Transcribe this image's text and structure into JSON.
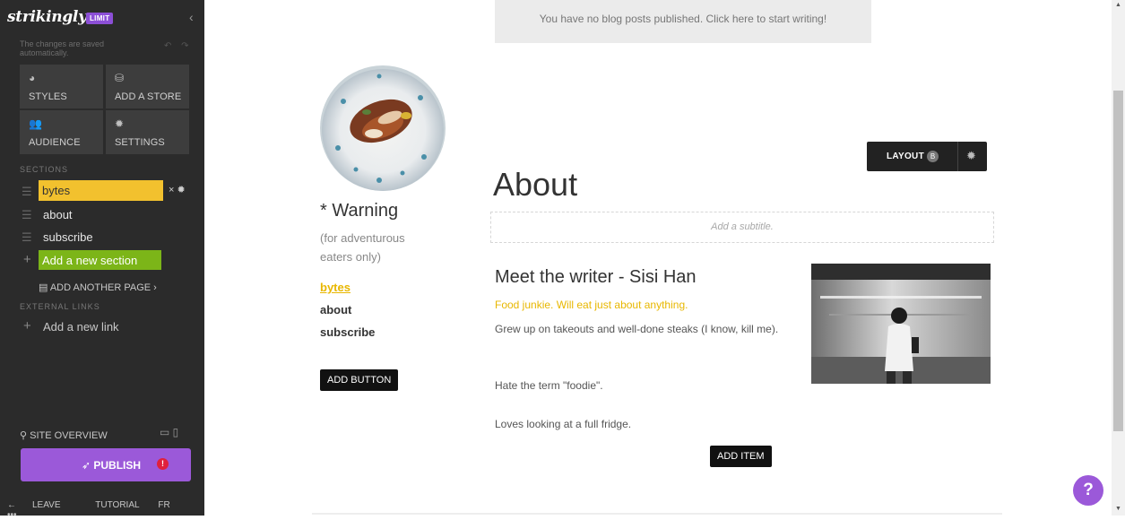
{
  "sidebar": {
    "logo": "strikingly",
    "badge": "LIMIT",
    "collapse_icon": "‹",
    "saved_note": "The changes are saved automatically.",
    "undo_redo_icons": "↶ ↷",
    "tiles": [
      {
        "label": "STYLES",
        "icon": "◕"
      },
      {
        "label": "ADD A STORE",
        "icon": "⛁"
      },
      {
        "label": "AUDIENCE",
        "icon": "👥"
      },
      {
        "label": "SETTINGS",
        "icon": "✹"
      }
    ],
    "sections_heading": "SECTIONS",
    "sections": [
      {
        "label": "bytes",
        "active": true
      },
      {
        "label": "about"
      },
      {
        "label": "subscribe"
      }
    ],
    "section_tools": "× ✹",
    "add_section": "Add a new section",
    "add_page": "ADD ANOTHER PAGE ›",
    "external_links_heading": "EXTERNAL LINKS",
    "add_link": "Add a new link",
    "site_overview": "SITE OVERVIEW",
    "device_icons": "▭ ▯",
    "publish": "PUBLISH",
    "publish_alert": "!",
    "bottom": {
      "leave": "LEAVE",
      "tutorial": "TUTORIAL",
      "lang": "FR",
      "more": "•••"
    }
  },
  "main": {
    "blog_banner": "You have no blog posts published. Click here to start writing!",
    "site_title": "* Warning",
    "site_subtitle": "(for adventurous eaters only)",
    "nav": [
      "bytes",
      "about",
      "subscribe"
    ],
    "add_button": "ADD BUTTON",
    "layout_button": "LAYOUT",
    "layout_badge": "B",
    "section_title": "About",
    "subtitle_placeholder": "Add a subtitle.",
    "item": {
      "title": "Meet the writer - Sisi Han",
      "tagline": "Food junkie. Will eat just about anything.",
      "paragraphs": [
        "Grew up on takeouts and well-done steaks (I know, kill me).",
        "Hate the term \"foodie\".",
        "Loves looking at a full fridge."
      ]
    },
    "add_item": "ADD ITEM",
    "help": "?"
  },
  "colors": {
    "sidebar_bg": "#2b2b2b",
    "accent_purple": "#9b59d9",
    "active_yellow": "#f2c12e",
    "add_green": "#7cb518",
    "link_gold": "#e8b700"
  }
}
